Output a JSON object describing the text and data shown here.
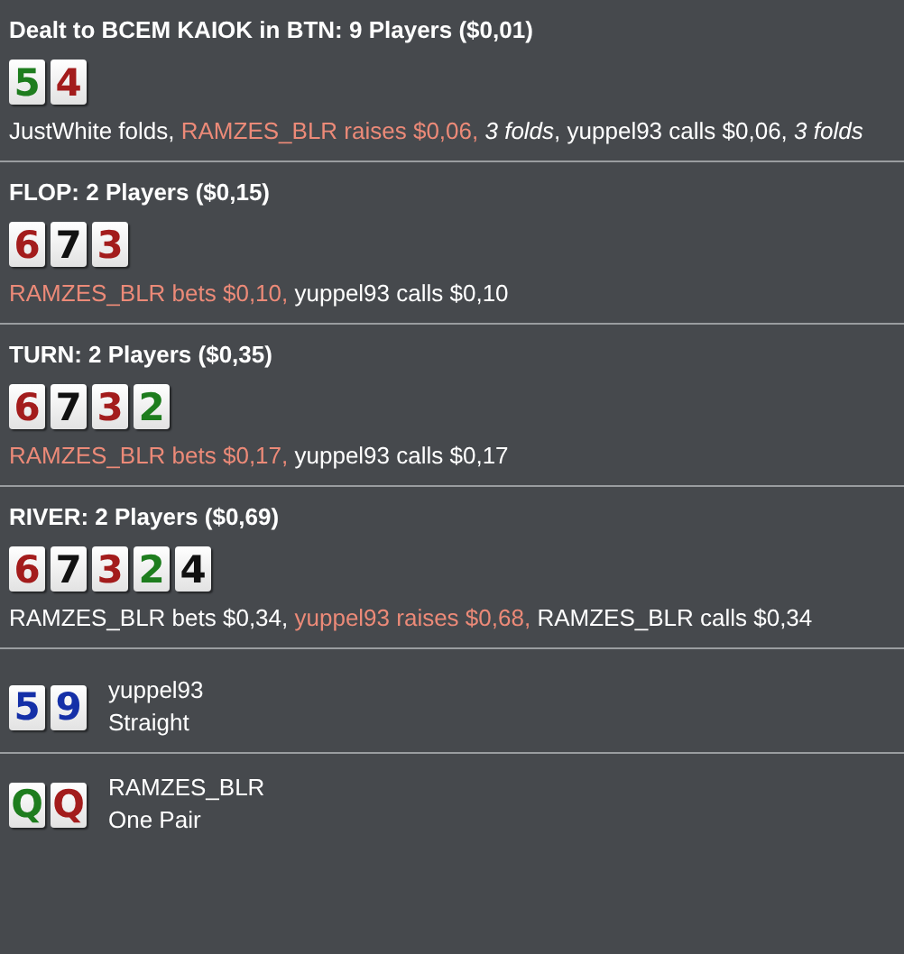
{
  "streets": [
    {
      "title": "Dealt to BCEM KAIOK in BTN: 9 Players ($0,01)",
      "cards": [
        {
          "rank": "5",
          "color": "#1e7d1e"
        },
        {
          "rank": "4",
          "color": "#a31c1c"
        }
      ],
      "actions": [
        {
          "text": "JustWhite folds, ",
          "kind": "plain"
        },
        {
          "text": "RAMZES_BLR raises $0,06, ",
          "kind": "hero"
        },
        {
          "text": "3 folds",
          "kind": "italic"
        },
        {
          "text": ", yuppel93 calls $0,06, ",
          "kind": "plain"
        },
        {
          "text": "3 folds",
          "kind": "italic"
        }
      ]
    },
    {
      "title": "FLOP: 2 Players ($0,15)",
      "cards": [
        {
          "rank": "6",
          "color": "#a31c1c"
        },
        {
          "rank": "7",
          "color": "#111111"
        },
        {
          "rank": "3",
          "color": "#a31c1c"
        }
      ],
      "actions": [
        {
          "text": "RAMZES_BLR bets $0,10, ",
          "kind": "hero"
        },
        {
          "text": "yuppel93 calls $0,10",
          "kind": "plain"
        }
      ]
    },
    {
      "title": "TURN: 2 Players ($0,35)",
      "cards": [
        {
          "rank": "6",
          "color": "#a31c1c"
        },
        {
          "rank": "7",
          "color": "#111111"
        },
        {
          "rank": "3",
          "color": "#a31c1c"
        },
        {
          "rank": "2",
          "color": "#1e7d1e"
        }
      ],
      "actions": [
        {
          "text": "RAMZES_BLR bets $0,17, ",
          "kind": "hero"
        },
        {
          "text": "yuppel93 calls $0,17",
          "kind": "plain"
        }
      ]
    },
    {
      "title": "RIVER: 2 Players ($0,69)",
      "cards": [
        {
          "rank": "6",
          "color": "#a31c1c"
        },
        {
          "rank": "7",
          "color": "#111111"
        },
        {
          "rank": "3",
          "color": "#a31c1c"
        },
        {
          "rank": "2",
          "color": "#1e7d1e"
        },
        {
          "rank": "4",
          "color": "#111111"
        }
      ],
      "actions": [
        {
          "text": "RAMZES_BLR bets $0,34, ",
          "kind": "plain"
        },
        {
          "text": "yuppel93 raises $0,68, ",
          "kind": "hero"
        },
        {
          "text": "RAMZES_BLR calls $0,34",
          "kind": "plain"
        }
      ]
    }
  ],
  "showdown": [
    {
      "player": "yuppel93",
      "hand": "Straight",
      "cards": [
        {
          "rank": "5",
          "color": "#1530a8"
        },
        {
          "rank": "9",
          "color": "#1530a8"
        }
      ]
    },
    {
      "player": "RAMZES_BLR",
      "hand": "One Pair",
      "cards": [
        {
          "rank": "Q",
          "color": "#1e7d1e"
        },
        {
          "rank": "Q",
          "color": "#a31c1c"
        }
      ]
    }
  ]
}
